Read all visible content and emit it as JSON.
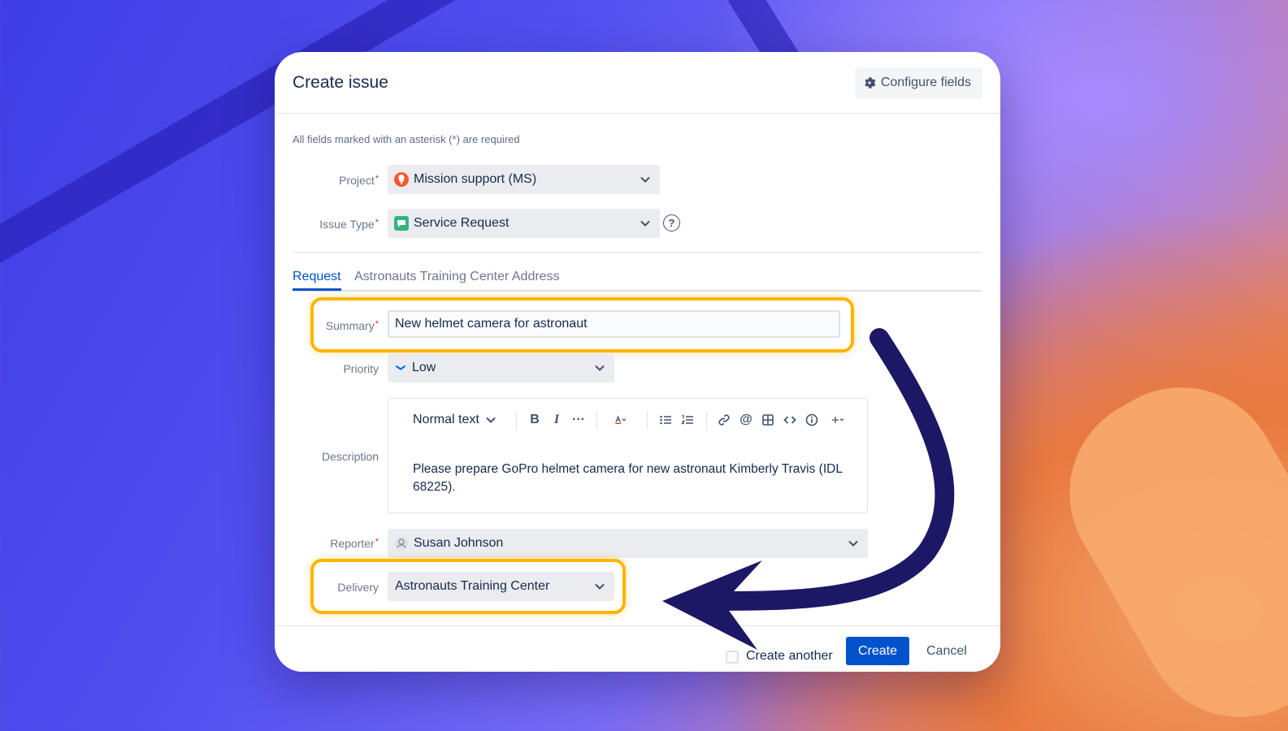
{
  "dialog": {
    "title": "Create issue",
    "configure_label": "Configure fields",
    "required_note": "All fields marked with an asterisk (*) are required"
  },
  "fields": {
    "project": {
      "label": "Project",
      "value": "Mission support (MS)"
    },
    "issue_type": {
      "label": "Issue Type",
      "value": "Service Request"
    },
    "summary": {
      "label": "Summary",
      "value": "New helmet camera for astronaut"
    },
    "priority": {
      "label": "Priority",
      "value": "Low"
    },
    "description": {
      "label": "Description",
      "text_style": "Normal text",
      "value": "Please prepare GoPro helmet camera for new astronaut Kimberly Travis (IDL 68225)."
    },
    "reporter": {
      "label": "Reporter",
      "value": "Susan Johnson"
    },
    "delivery": {
      "label": "Delivery",
      "value": "Astronauts Training Center"
    }
  },
  "tabs": [
    {
      "label": "Request",
      "active": true
    },
    {
      "label": "Astronauts Training Center Address",
      "active": false
    }
  ],
  "footer": {
    "create_another_label": "Create another",
    "create_label": "Create",
    "cancel_label": "Cancel"
  },
  "colors": {
    "primary": "#0052cc",
    "highlight": "#ffb400",
    "arrow": "#1c1866",
    "required": "#de350b"
  },
  "icons": [
    "gear-icon",
    "project-avatar-icon",
    "service-request-icon",
    "help-icon",
    "chevron-down-icon",
    "priority-low-icon",
    "bold-icon",
    "italic-icon",
    "more-icon",
    "text-color-icon",
    "bullet-list-icon",
    "numbered-list-icon",
    "link-icon",
    "mention-icon",
    "table-icon",
    "code-icon",
    "info-icon",
    "plus-icon",
    "user-avatar-icon",
    "curved-arrow-icon"
  ]
}
